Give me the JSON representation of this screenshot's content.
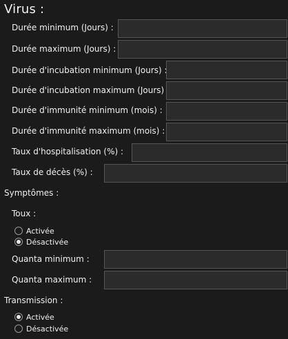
{
  "virus": {
    "title": "Virus :",
    "fields": {
      "duree_min": {
        "label": "Durée minimum (Jours) :",
        "value": ""
      },
      "duree_max": {
        "label": "Durée maximum (Jours) :",
        "value": ""
      },
      "incub_min": {
        "label": "Durée d'incubation minimum (Jours) :",
        "value": ""
      },
      "incub_max": {
        "label": "Durée d'incubation maximum (Jours) :",
        "value": ""
      },
      "immun_min": {
        "label": "Durée d'immunité minimum (mois) :",
        "value": ""
      },
      "immun_max": {
        "label": "Durée d'immunité maximum (mois) :",
        "value": ""
      },
      "hospit": {
        "label": "Taux d'hospitalisation (%) :",
        "value": ""
      },
      "deces": {
        "label": "Taux de décès (%) :",
        "value": ""
      }
    }
  },
  "symptomes": {
    "title": "Symptômes :",
    "toux": {
      "label": "Toux :",
      "options": {
        "on": "Activée",
        "off": "Désactivée"
      },
      "selected": "Désactivée"
    },
    "quanta_min": {
      "label": "Quanta minimum :",
      "value": ""
    },
    "quanta_max": {
      "label": "Quanta maximum :",
      "value": ""
    }
  },
  "transmission": {
    "title": "Transmission :",
    "options": {
      "on": "Activée",
      "off": "Désactivée"
    },
    "selected": "Activée"
  }
}
